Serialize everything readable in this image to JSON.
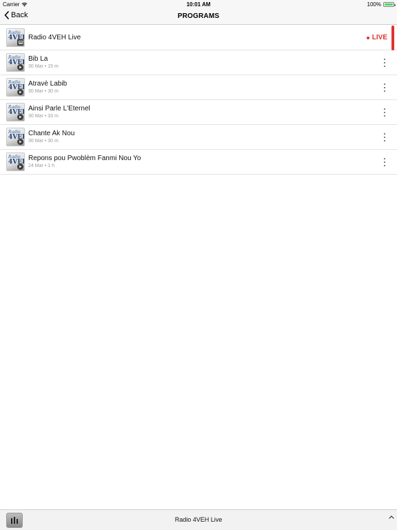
{
  "status_bar": {
    "carrier": "Carrier",
    "time": "10:01 AM",
    "battery": "100%",
    "battery_level": 1.0,
    "battery_color": "#4cd964"
  },
  "nav": {
    "back_label": "Back",
    "title": "PROGRAMS"
  },
  "accent_color": "#e0322f",
  "live_item": {
    "title": "Radio 4VEH Live",
    "live_label": "LIVE",
    "icon": "live-stream-icon"
  },
  "programs": [
    {
      "title": "Bib La",
      "date": "30 Mar",
      "duration": "15 m"
    },
    {
      "title": "Atravè Labib",
      "date": "30 Mar",
      "duration": "30 m"
    },
    {
      "title": "Ainsi Parle L'Eternel",
      "date": "30 Mar",
      "duration": "33 m"
    },
    {
      "title": "Chante Ak Nou",
      "date": "30 Mar",
      "duration": "30 m"
    },
    {
      "title": "Repons pou Pwoblèm Fanmi Nou Yo",
      "date": "24 Mar",
      "duration": "1 h"
    }
  ],
  "thumbnail": {
    "logo_line1": "Radio",
    "logo_line2": "4VEH"
  },
  "mini_player": {
    "title": "Radio 4VEH Live"
  }
}
